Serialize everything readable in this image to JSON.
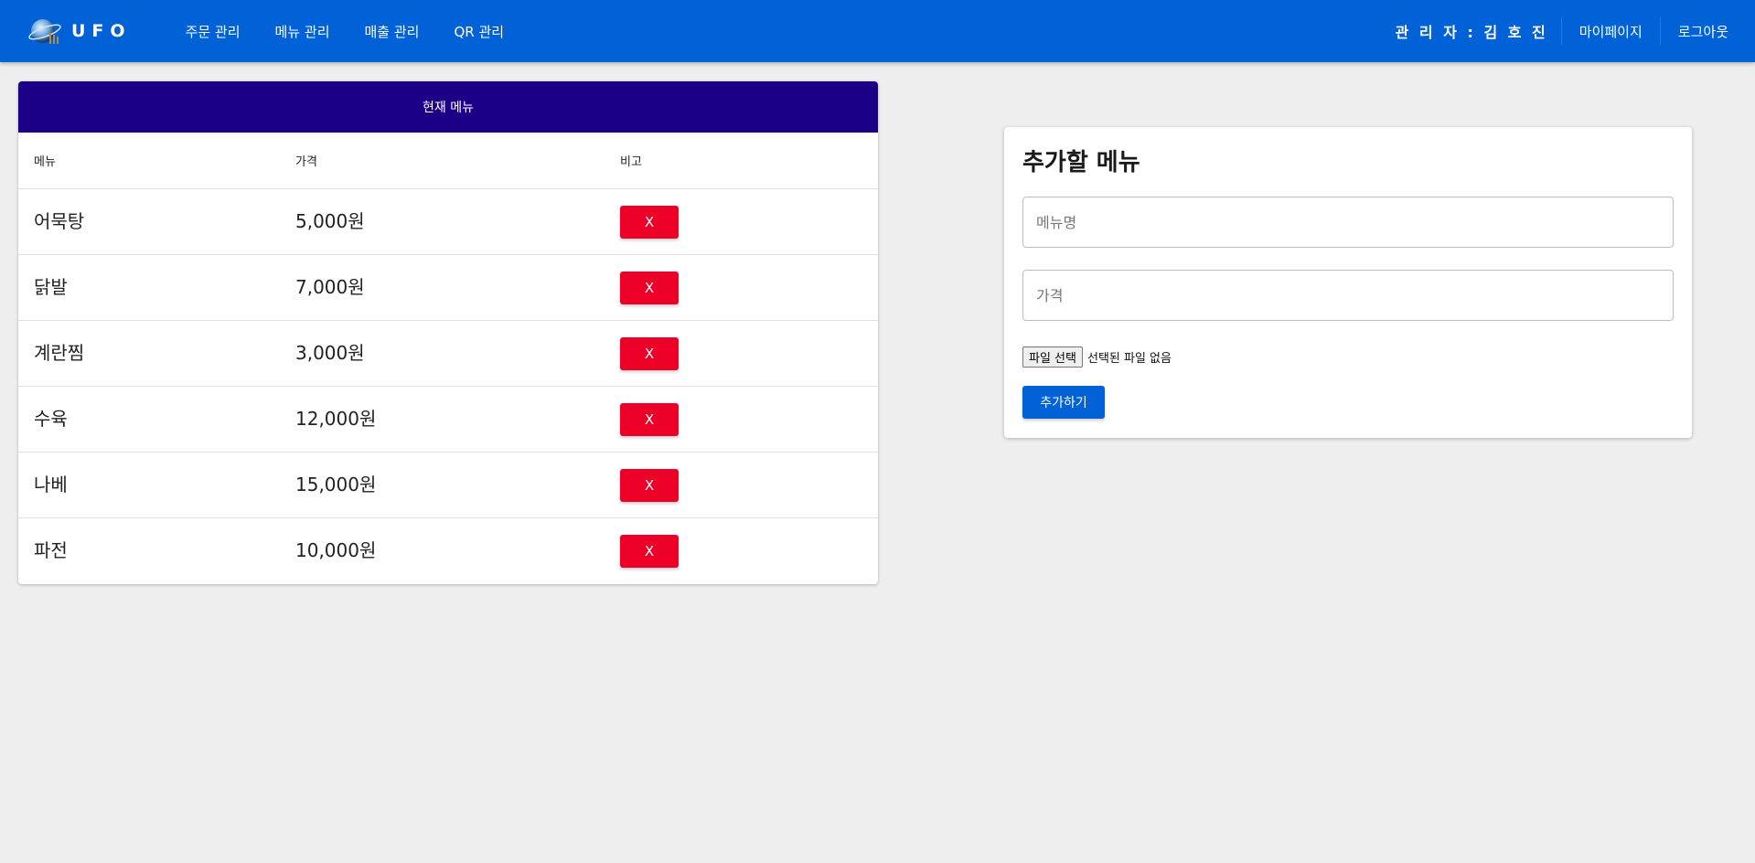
{
  "header": {
    "brand": "UFO",
    "logo_icon": "planet-logo-icon",
    "nav": [
      "주문 관리",
      "메뉴 관리",
      "매출 관리",
      "QR 관리"
    ],
    "admin_label": "관 리 자 : 김 호 진",
    "mypage": "마이페이지",
    "logout": "로그아웃"
  },
  "current_menu": {
    "title": "현재 메뉴",
    "columns": {
      "name": "메뉴",
      "price": "가격",
      "note": "비고"
    },
    "delete_label": "X",
    "rows": [
      {
        "name": "어묵탕",
        "price": "5,000원"
      },
      {
        "name": "닭발",
        "price": "7,000원"
      },
      {
        "name": "계란찜",
        "price": "3,000원"
      },
      {
        "name": "수육",
        "price": "12,000원"
      },
      {
        "name": "나베",
        "price": "15,000원"
      },
      {
        "name": "파전",
        "price": "10,000원"
      }
    ]
  },
  "add_menu": {
    "title": "추가할 메뉴",
    "name_placeholder": "메뉴명",
    "price_placeholder": "가격",
    "file_button": "파일 선택",
    "file_status": "선택된 파일 없음",
    "submit": "추가하기"
  },
  "colors": {
    "appbar": "#0062d6",
    "table_header": "#1b0087",
    "delete_button": "#ec0028"
  }
}
